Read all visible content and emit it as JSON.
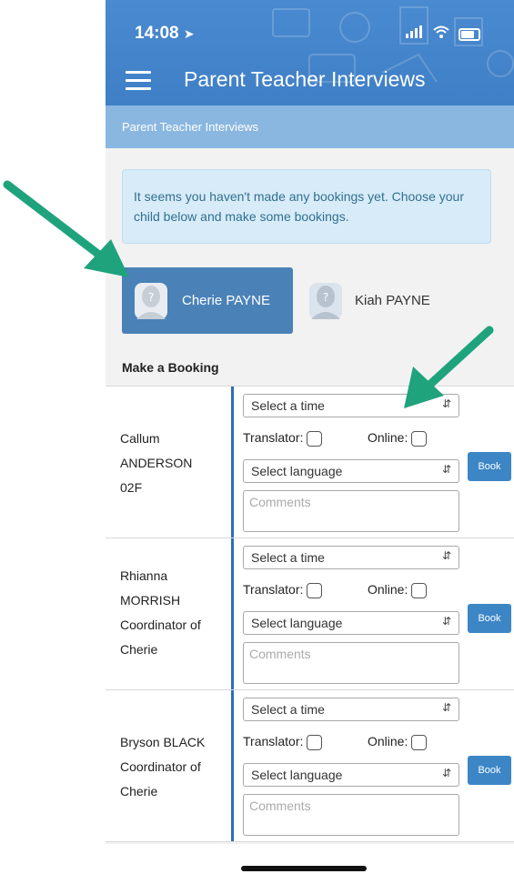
{
  "status_bar": {
    "time": "14:08"
  },
  "header": {
    "title": "Parent Teacher Interviews"
  },
  "breadcrumb": "Parent Teacher Interviews",
  "notice": "It seems you haven't made any bookings yet. Choose your child below and make some bookings.",
  "children": [
    {
      "name": "Cherie PAYNE",
      "active": true
    },
    {
      "name": "Kiah PAYNE",
      "active": false
    }
  ],
  "section_title": "Make a Booking",
  "booking_form": {
    "time_placeholder": "Select a time",
    "translator_label": "Translator:",
    "online_label": "Online:",
    "language_placeholder": "Select language",
    "comments_placeholder": "Comments",
    "book_label": "Book"
  },
  "teachers": [
    {
      "lines": [
        "Callum",
        "ANDERSON",
        "02F"
      ]
    },
    {
      "lines": [
        "Rhianna",
        "MORRISH",
        "Coordinator of",
        "Cherie"
      ]
    },
    {
      "lines": [
        "Bryson BLACK",
        "Coordinator of",
        "Cherie"
      ]
    }
  ],
  "colors": {
    "header_blue": "#4a8ad0",
    "active_tab": "#4a82b8",
    "book_button": "#3c86c6",
    "arrow_green": "#1fa37d"
  },
  "icons": [
    "hamburger-icon",
    "location-arrow-icon",
    "signal-icon",
    "wifi-icon",
    "battery-icon",
    "avatar-icon",
    "select-caret-icon"
  ]
}
